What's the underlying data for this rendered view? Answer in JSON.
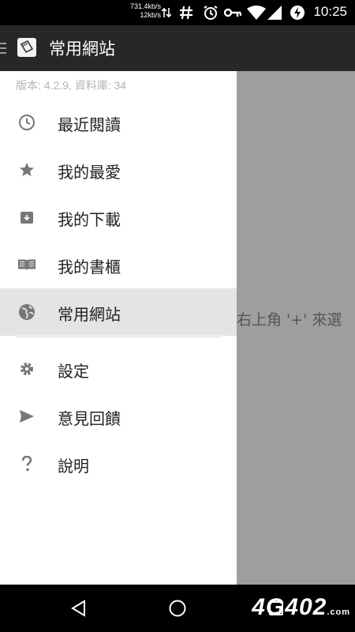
{
  "status": {
    "speed_up": "731.4kb/s",
    "speed_down": "12kb/s",
    "time": "10:25"
  },
  "app": {
    "title": "常用網站"
  },
  "drawer": {
    "version": "版本: 4.2.9, 資料庫: 34",
    "items": [
      {
        "label": "最近閱讀",
        "icon": "clock-icon"
      },
      {
        "label": "我的最愛",
        "icon": "star-icon"
      },
      {
        "label": "我的下載",
        "icon": "archive-icon"
      },
      {
        "label": "我的書櫃",
        "icon": "book-icon"
      },
      {
        "label": "常用網站",
        "icon": "globe-icon",
        "active": true
      }
    ],
    "secondary_items": [
      {
        "label": "設定",
        "icon": "gear-icon"
      },
      {
        "label": "意見回饋",
        "icon": "send-icon"
      },
      {
        "label": "說明",
        "icon": "help-icon"
      }
    ]
  },
  "content": {
    "hint_text": "右上角 '+' 來選"
  },
  "watermark": {
    "brand": "4G402",
    "suffix": ".com"
  },
  "colors": {
    "appbar": "#272727",
    "drawer_bg": "#ffffff",
    "active_item_bg": "#e4e4e4",
    "scrim": "#9e9e9e"
  }
}
